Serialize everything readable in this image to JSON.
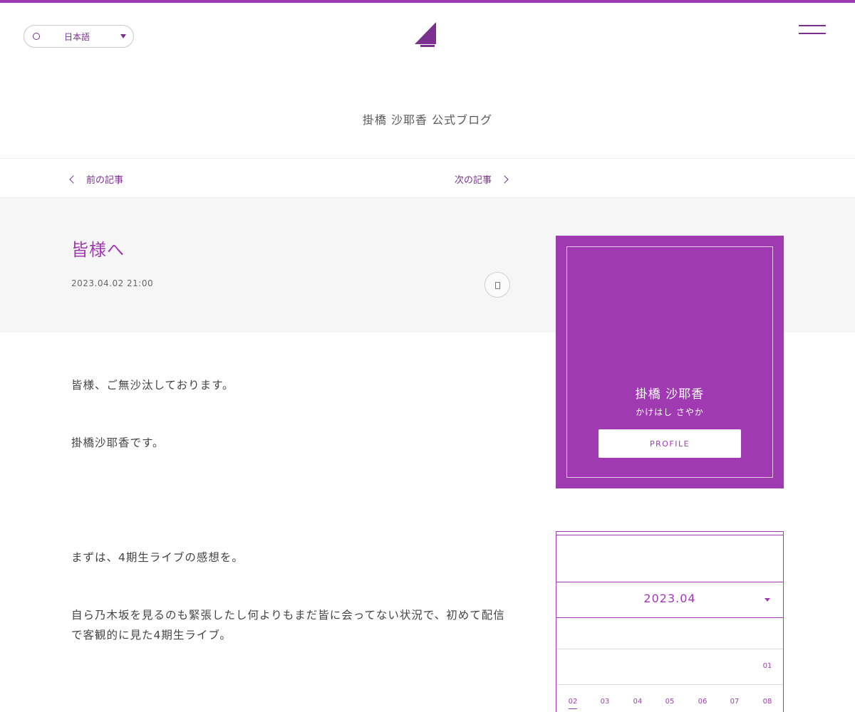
{
  "header": {
    "language": "日本語",
    "blog_title": "掛橋 沙耶香 公式ブログ"
  },
  "nav": {
    "prev": "前の記事",
    "next": "次の記事"
  },
  "post": {
    "title": "皆様へ",
    "date": "2023.04.02 21:00",
    "paragraphs": [
      "皆様、ご無沙汰しております。",
      "掛橋沙耶香です。",
      "まずは、4期生ライブの感想を。",
      "自ら乃木坂を見るのも緊張したし何よりもまだ皆に会ってない状況で、初めて配信で客観的に見た4期生ライブ。"
    ]
  },
  "profile": {
    "name": "掛橋 沙耶香",
    "kana": "かけはし さやか",
    "button": "PROFILE"
  },
  "calendar": {
    "month": "2023.04",
    "days_row1": [
      "01"
    ],
    "days_row2": [
      "02",
      "03",
      "04",
      "05",
      "06",
      "07",
      "08"
    ],
    "selected": "02"
  },
  "colors": {
    "accent": "#a03ab3",
    "text": "#444444",
    "band": "#f6f6f6"
  }
}
